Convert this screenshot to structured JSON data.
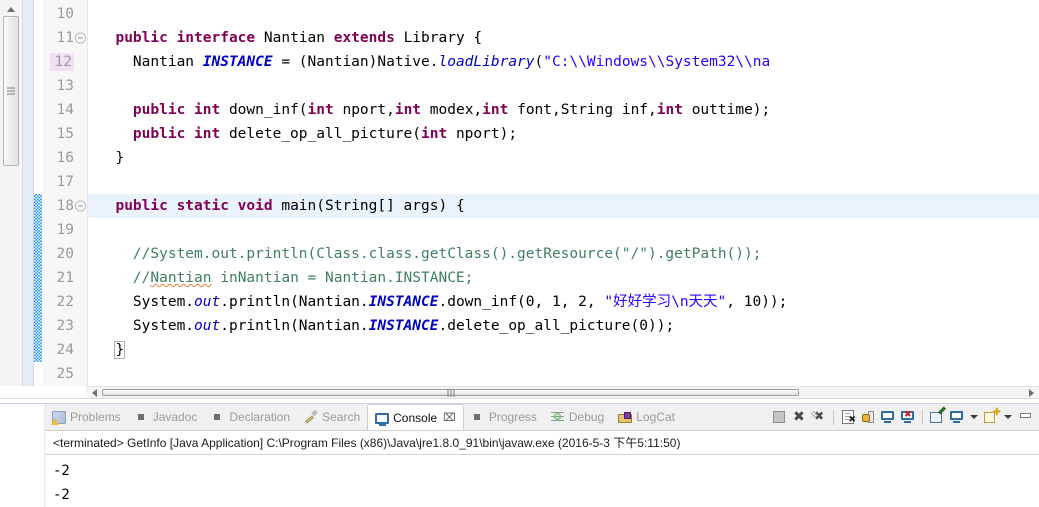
{
  "editor": {
    "first_visible_line": 10,
    "current_line": 18,
    "changed_line": 12,
    "method_range": [
      18,
      24
    ],
    "lines": [
      {
        "num": 10,
        "fold": false,
        "tokens": []
      },
      {
        "num": 11,
        "fold": true,
        "tokens": [
          {
            "t": "  ",
            "c": "plain"
          },
          {
            "t": "public interface ",
            "c": "kw"
          },
          {
            "t": "Nantian ",
            "c": "plain"
          },
          {
            "t": "extends ",
            "c": "kw"
          },
          {
            "t": "Library {",
            "c": "plain"
          }
        ]
      },
      {
        "num": 12,
        "fold": false,
        "tokens": [
          {
            "t": "    Nantian ",
            "c": "plain"
          },
          {
            "t": "INSTANCE",
            "c": "sfld"
          },
          {
            "t": " = (Nantian)Native.",
            "c": "plain"
          },
          {
            "t": "loadLibrary",
            "c": "fld"
          },
          {
            "t": "(",
            "c": "plain"
          },
          {
            "t": "\"C:\\\\Windows\\\\System32\\\\na",
            "c": "str"
          }
        ]
      },
      {
        "num": 13,
        "fold": false,
        "tokens": []
      },
      {
        "num": 14,
        "fold": false,
        "tokens": [
          {
            "t": "    ",
            "c": "plain"
          },
          {
            "t": "public int ",
            "c": "kw"
          },
          {
            "t": "down_inf(",
            "c": "plain"
          },
          {
            "t": "int",
            "c": "kw"
          },
          {
            "t": " nport,",
            "c": "plain"
          },
          {
            "t": "int",
            "c": "kw"
          },
          {
            "t": " modex,",
            "c": "plain"
          },
          {
            "t": "int",
            "c": "kw"
          },
          {
            "t": " font,String inf,",
            "c": "plain"
          },
          {
            "t": "int",
            "c": "kw"
          },
          {
            "t": " outtime);",
            "c": "plain"
          }
        ]
      },
      {
        "num": 15,
        "fold": false,
        "tokens": [
          {
            "t": "    ",
            "c": "plain"
          },
          {
            "t": "public int ",
            "c": "kw"
          },
          {
            "t": "delete_op_all_picture(",
            "c": "plain"
          },
          {
            "t": "int",
            "c": "kw"
          },
          {
            "t": " nport);",
            "c": "plain"
          }
        ]
      },
      {
        "num": 16,
        "fold": false,
        "tokens": [
          {
            "t": "  }",
            "c": "plain"
          }
        ]
      },
      {
        "num": 17,
        "fold": false,
        "tokens": []
      },
      {
        "num": 18,
        "fold": true,
        "tokens": [
          {
            "t": "  ",
            "c": "plain"
          },
          {
            "t": "public static void ",
            "c": "kw"
          },
          {
            "t": "main(String[] args) {",
            "c": "plain"
          }
        ]
      },
      {
        "num": 19,
        "fold": false,
        "tokens": []
      },
      {
        "num": 20,
        "fold": false,
        "tokens": [
          {
            "t": "    ",
            "c": "plain"
          },
          {
            "t": "//System.out.println(Class.class.getClass().getResource(\"/\").getPath());",
            "c": "cmt"
          }
        ]
      },
      {
        "num": 21,
        "fold": false,
        "tokens": [
          {
            "t": "    ",
            "c": "plain"
          },
          {
            "t": "//",
            "c": "cmt"
          },
          {
            "t": "Nantian",
            "c": "cmt misspell"
          },
          {
            "t": " inNantian = Nantian.INSTANCE;",
            "c": "cmt"
          }
        ]
      },
      {
        "num": 22,
        "fold": false,
        "tokens": [
          {
            "t": "    System.",
            "c": "plain"
          },
          {
            "t": "out",
            "c": "fld"
          },
          {
            "t": ".println(Nantian.",
            "c": "plain"
          },
          {
            "t": "INSTANCE",
            "c": "sfld"
          },
          {
            "t": ".down_inf(0, 1, 2, ",
            "c": "plain"
          },
          {
            "t": "\"好好学习\\n天天\"",
            "c": "str"
          },
          {
            "t": ", 10));",
            "c": "plain"
          }
        ]
      },
      {
        "num": 23,
        "fold": false,
        "tokens": [
          {
            "t": "    System.",
            "c": "plain"
          },
          {
            "t": "out",
            "c": "fld"
          },
          {
            "t": ".println(Nantian.",
            "c": "plain"
          },
          {
            "t": "INSTANCE",
            "c": "sfld"
          },
          {
            "t": ".delete_op_all_picture(0));",
            "c": "plain"
          }
        ]
      },
      {
        "num": 24,
        "fold": false,
        "tokens": [
          {
            "t": "  ",
            "c": "plain"
          },
          {
            "t": "}",
            "c": "plain brace-box"
          }
        ]
      },
      {
        "num": 25,
        "fold": false,
        "tokens": []
      }
    ]
  },
  "bottom_view": {
    "tabs": [
      {
        "label": "Problems",
        "icon": "problems-icon",
        "active": false,
        "closable": false
      },
      {
        "label": "Javadoc",
        "icon": "square-gray-icon",
        "active": false,
        "closable": false
      },
      {
        "label": "Declaration",
        "icon": "square-gray-icon",
        "active": false,
        "closable": false
      },
      {
        "label": "Search",
        "icon": "search-icon",
        "active": false,
        "closable": false
      },
      {
        "label": "Console",
        "icon": "console-icon",
        "active": true,
        "closable": true
      },
      {
        "label": "Progress",
        "icon": "square-gray-icon",
        "active": false,
        "closable": false
      },
      {
        "label": "Debug",
        "icon": "debug-icon",
        "active": false,
        "closable": false
      },
      {
        "label": "LogCat",
        "icon": "logcat-icon",
        "active": false,
        "closable": false
      }
    ],
    "toolbar": [
      {
        "name": "terminate-button",
        "tooltip": "Terminate"
      },
      {
        "name": "remove-launch-button",
        "tooltip": "Remove Launch"
      },
      {
        "name": "remove-all-terminated-button",
        "tooltip": "Remove All Terminated Launches"
      },
      {
        "name": "clear-console-button",
        "tooltip": "Clear Console"
      },
      {
        "name": "scroll-lock-button",
        "tooltip": "Scroll Lock"
      },
      {
        "name": "show-console-button",
        "tooltip": "Show Console When Standard Out Changes"
      },
      {
        "name": "show-console-err-button",
        "tooltip": "Show Console When Standard Error Changes"
      },
      {
        "name": "pin-console-button",
        "tooltip": "Pin Console"
      },
      {
        "name": "display-selected-console-button",
        "tooltip": "Display Selected Console"
      },
      {
        "name": "display-selected-console-menu",
        "tooltip": "Display Selected Console Menu"
      },
      {
        "name": "open-console-button",
        "tooltip": "Open Console"
      },
      {
        "name": "open-console-menu",
        "tooltip": "Open Console Menu"
      },
      {
        "name": "minimize-button",
        "tooltip": "Minimize"
      }
    ],
    "console_header": "<terminated> GetInfo [Java Application] C:\\Program Files (x86)\\Java\\jre1.8.0_91\\bin\\javaw.exe (2016-5-3 下午5:11:50)",
    "console_output": [
      "-2",
      "-2"
    ]
  },
  "colors": {
    "keyword": "#7f0055",
    "string": "#2a00ff",
    "comment": "#3f7f5f",
    "field": "#0000c0",
    "current_line_bg": "#eaf2fb",
    "changed_line_bg": "#efdff0",
    "range_bar": "#1a8fe3",
    "spellcheck_underline": "#e07a30"
  }
}
